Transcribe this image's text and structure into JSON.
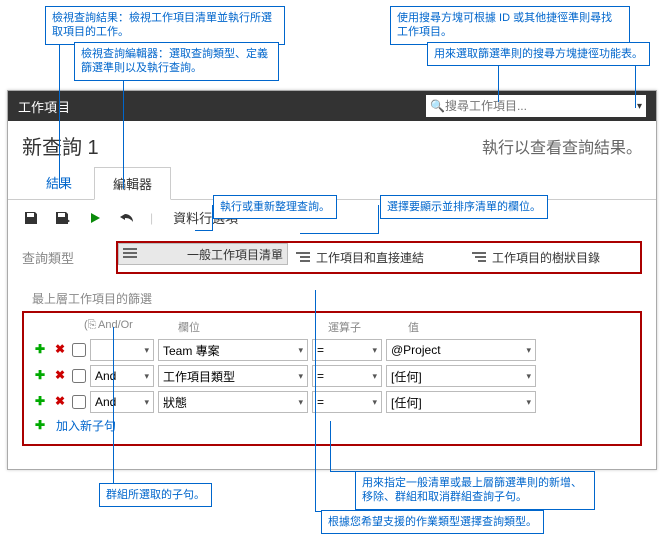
{
  "callouts": {
    "c1": "檢視查詢結果：檢視工作項目清單並執行所選取項目的工作。",
    "c2": "檢視查詢編輯器：選取查詢類型、定義篩選準則以及執行查詢。",
    "c3": "使用搜尋方塊可根據 ID 或其他捷徑準則尋找工作項目。",
    "c4": "用來選取篩選準則的搜尋方塊捷徑功能表。",
    "c5": "執行或重新整理查詢。",
    "c6": "選擇要顯示並排序清單的欄位。",
    "c7": "群組所選取的子句。",
    "c8": "用來指定一般清單或最上層篩選準則的新增、移除、群組和取消群組查詢子句。",
    "c9": "根據您希望支援的作業類型選擇查詢類型。"
  },
  "topbar": {
    "title": "工作項目"
  },
  "search": {
    "placeholder": "搜尋工作項目..."
  },
  "header": {
    "title": "新查詢 1",
    "exec_hint": "執行以查看查詢結果。"
  },
  "tabs": {
    "t0": "結果",
    "t1": "編輯器"
  },
  "toolbar": {
    "col_options": "資料行選項"
  },
  "qtype": {
    "label": "查詢類型",
    "opt0": "一般工作項目清單",
    "opt1": "工作項目和直接連結",
    "opt2": "工作項目的樹狀目錄"
  },
  "filter": {
    "section_title": "最上層工作項目的篩選",
    "head_andor": "And/Or",
    "head_field": "欄位",
    "head_op": "運算子",
    "head_val": "值",
    "rows": [
      {
        "andor": "",
        "field": "Team 專案",
        "op": "=",
        "val": "@Project"
      },
      {
        "andor": "And",
        "field": "工作項目類型",
        "op": "=",
        "val": "[任何]"
      },
      {
        "andor": "And",
        "field": "狀態",
        "op": "=",
        "val": "[任何]"
      }
    ],
    "add_clause": "加入新子句"
  }
}
